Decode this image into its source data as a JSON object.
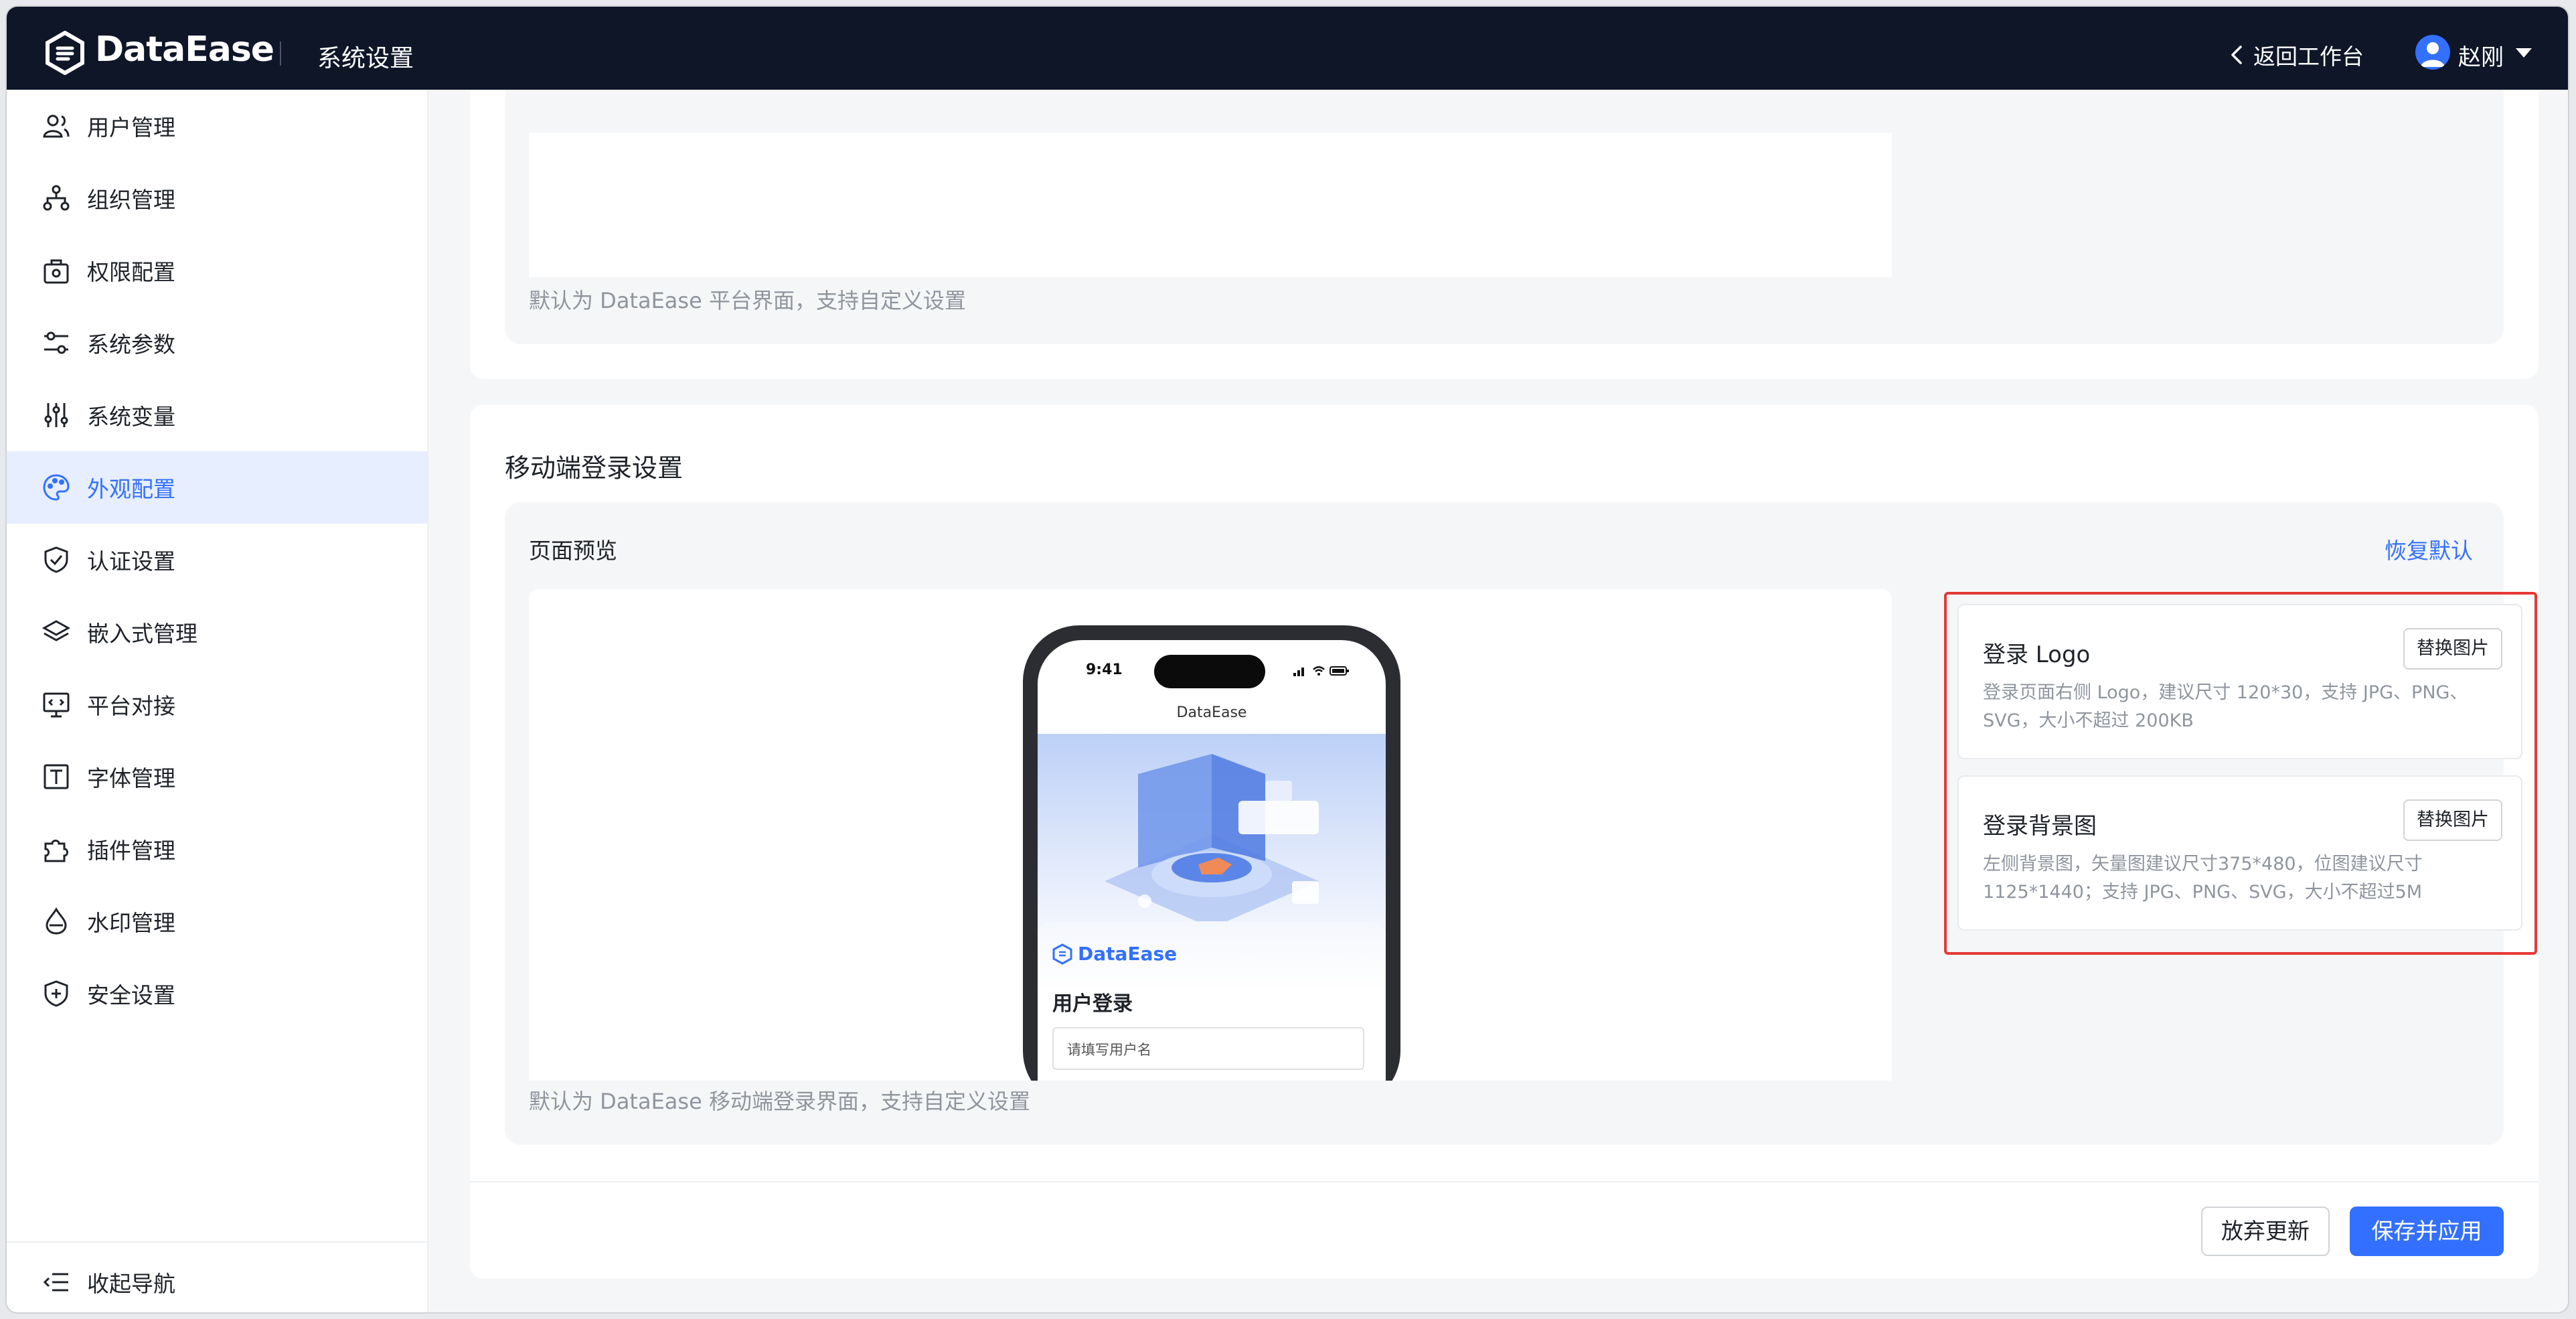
{
  "header": {
    "brand": "DataEase",
    "page_title": "系统设置",
    "back_label": "返回工作台",
    "user_name": "赵刚"
  },
  "sidebar": {
    "items": [
      {
        "label": "用户管理",
        "icon": "users-icon",
        "active": false
      },
      {
        "label": "组织管理",
        "icon": "org-tree-icon",
        "active": false
      },
      {
        "label": "权限配置",
        "icon": "lock-bag-icon",
        "active": false
      },
      {
        "label": "系统参数",
        "icon": "sliders-icon",
        "active": false
      },
      {
        "label": "系统变量",
        "icon": "vertical-sliders-icon",
        "active": false
      },
      {
        "label": "外观配置",
        "icon": "palette-icon",
        "active": true
      },
      {
        "label": "认证设置",
        "icon": "shield-check-icon",
        "active": false
      },
      {
        "label": "嵌入式管理",
        "icon": "layers-icon",
        "active": false
      },
      {
        "label": "平台对接",
        "icon": "monitor-code-icon",
        "active": false
      },
      {
        "label": "字体管理",
        "icon": "font-t-icon",
        "active": false
      },
      {
        "label": "插件管理",
        "icon": "puzzle-icon",
        "active": false
      },
      {
        "label": "水印管理",
        "icon": "droplet-icon",
        "active": false
      },
      {
        "label": "安全设置",
        "icon": "shield-plus-icon",
        "active": false
      }
    ],
    "collapse_label": "收起导航"
  },
  "top_card": {
    "hint": "默认为 DataEase 平台界面，支持自定义设置"
  },
  "mobile_section": {
    "title": "移动端登录设置",
    "preview_label": "页面预览",
    "restore_label": "恢复默认",
    "hint": "默认为 DataEase 移动端登录界面，支持自定义设置",
    "phone": {
      "time": "9:41",
      "app_title": "DataEase",
      "brand": "DataEase",
      "login_title": "用户登录",
      "username_placeholder": "请填写用户名"
    },
    "settings": [
      {
        "title": "登录 Logo",
        "button": "替换图片",
        "desc": "登录页面右侧 Logo，建议尺寸 120*30，支持 JPG、PNG、SVG，大小不超过 200KB"
      },
      {
        "title": "登录背景图",
        "button": "替换图片",
        "desc": "左侧背景图，矢量图建议尺寸375*480，位图建议尺寸 1125*1440；支持 JPG、PNG、SVG，大小不超过5M"
      }
    ]
  },
  "footer": {
    "discard_label": "放弃更新",
    "save_label": "保存并应用"
  },
  "colors": {
    "accent": "#3370ff",
    "header_bg": "#0e1628",
    "highlight_border": "#e53935"
  }
}
